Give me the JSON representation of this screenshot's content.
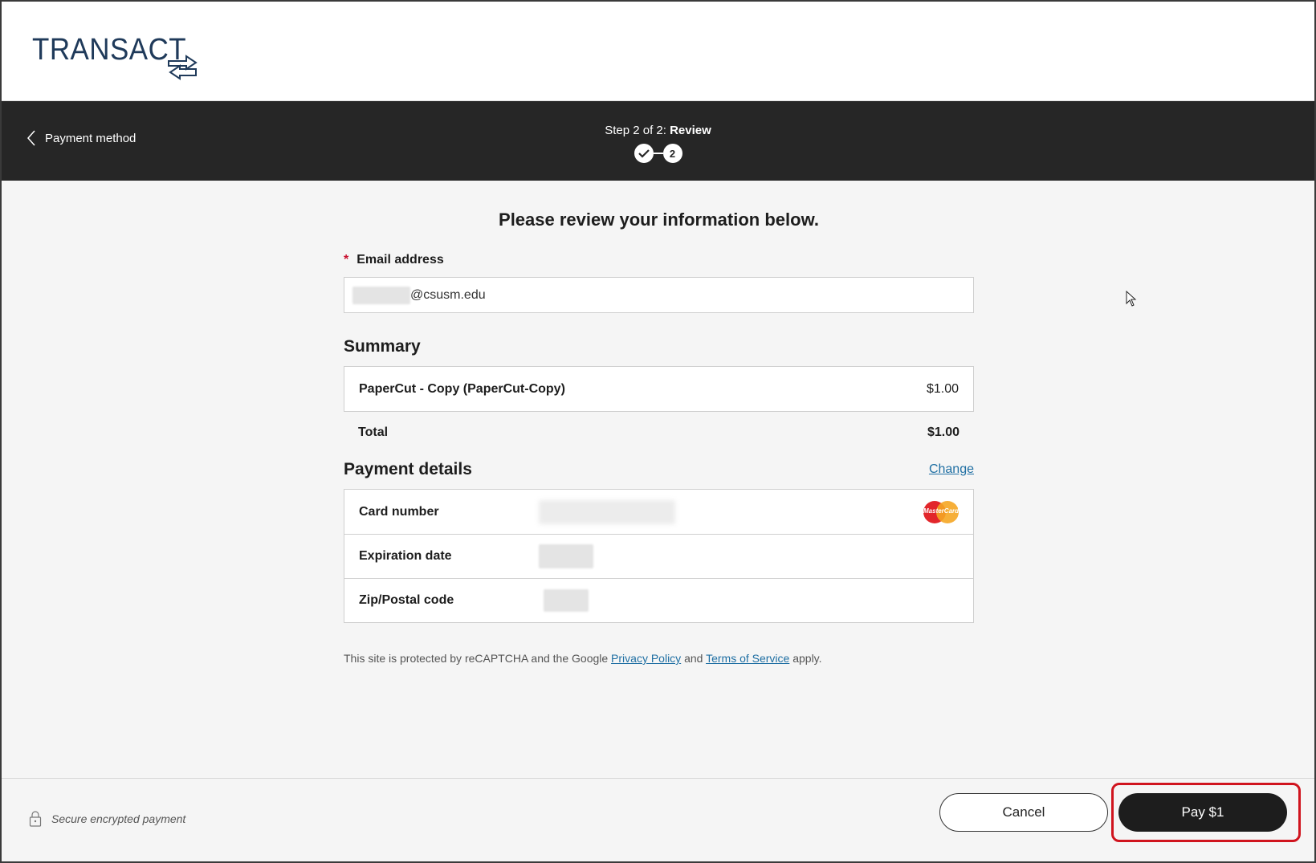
{
  "app": {
    "logo_text": "TRANSACT"
  },
  "stepbar": {
    "back_label": "Payment method",
    "step_prefix": "Step 2 of 2: ",
    "step_name": "Review",
    "step_current_number": "2"
  },
  "main": {
    "heading": "Please review your information below.",
    "email": {
      "required_mark": "*",
      "label": "Email address",
      "value_visible": "@csusm.edu"
    },
    "summary": {
      "title": "Summary",
      "items": [
        {
          "name": "PaperCut - Copy (PaperCut-Copy)",
          "amount": "$1.00"
        }
      ],
      "total_label": "Total",
      "total_amount": "$1.00"
    },
    "payment_details": {
      "title": "Payment details",
      "change_label": "Change",
      "card_number_label": "Card number",
      "card_brand": "MasterCard",
      "expiration_label": "Expiration date",
      "zip_label": "Zip/Postal code"
    },
    "recaptcha": {
      "prefix": "This site is protected by reCAPTCHA and the Google ",
      "privacy_label": "Privacy Policy",
      "and": " and ",
      "terms_label": "Terms of Service",
      "suffix": " apply."
    }
  },
  "footer": {
    "secure_label": "Secure encrypted payment",
    "cancel_label": "Cancel",
    "pay_label": "Pay $1"
  },
  "colors": {
    "brand_navy": "#1f3a5a",
    "stepbar_bg": "#262626",
    "link": "#1f6fa3",
    "required": "#c8102e",
    "highlight": "#d0141e"
  }
}
